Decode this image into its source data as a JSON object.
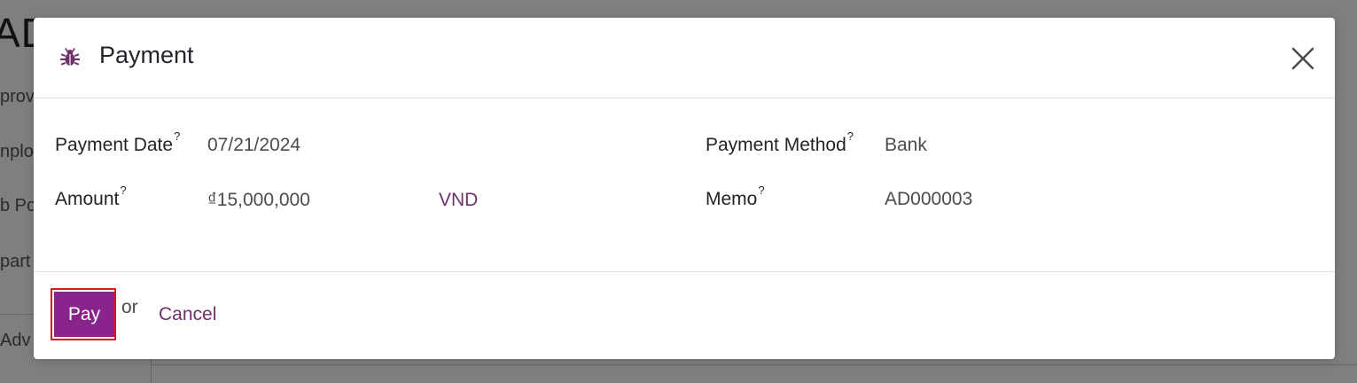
{
  "background": {
    "title_fragment": "AD",
    "menu_fragments": [
      "prov",
      "nplo",
      "b Po",
      "part",
      "Adv"
    ]
  },
  "modal": {
    "title": "Payment",
    "icon": "bug-icon",
    "accent_color": "#88248b"
  },
  "fields": {
    "payment_date": {
      "label": "Payment Date",
      "help": "?",
      "value": "07/21/2024"
    },
    "amount": {
      "label": "Amount",
      "help": "?",
      "value": "₫15,000,000",
      "currency": "VND"
    },
    "payment_method": {
      "label": "Payment Method",
      "help": "?",
      "value": "Bank"
    },
    "memo": {
      "label": "Memo",
      "help": "?",
      "value": "AD000003"
    }
  },
  "footer": {
    "pay_label": "Pay",
    "or_text": "or",
    "cancel_label": "Cancel"
  }
}
